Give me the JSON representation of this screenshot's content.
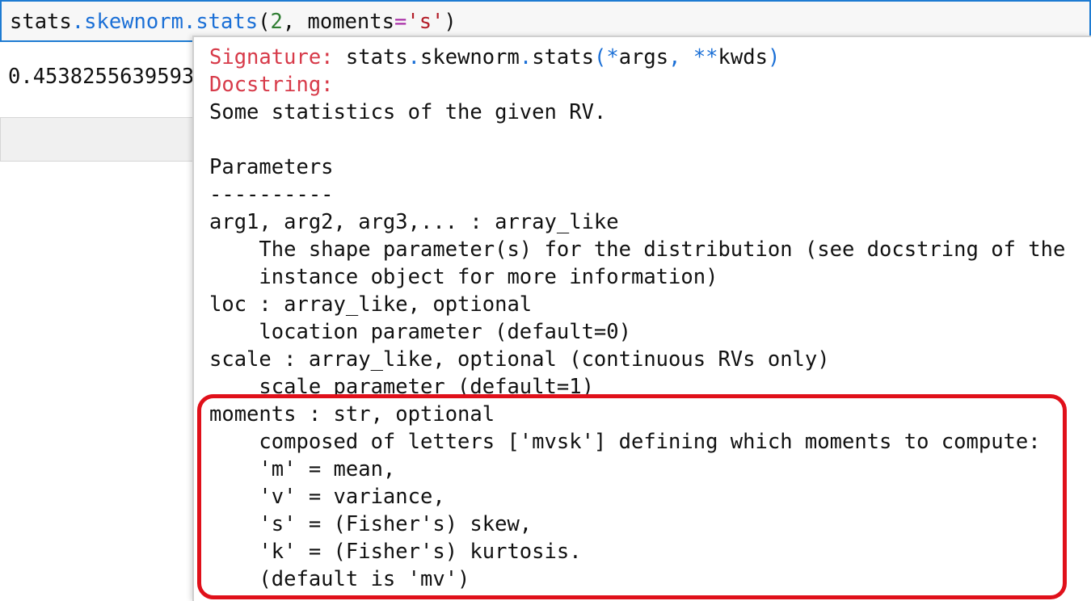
{
  "code_cell": {
    "tokens": {
      "var": "stats",
      "dot1": ".",
      "module": "skewnorm",
      "dot2": ".",
      "fn": "stats",
      "paren_open": "(",
      "num": "2",
      "comma": ", ",
      "kw": "moments",
      "eq": "=",
      "str": "'s'",
      "paren_close": ")"
    }
  },
  "output": {
    "value": "0.4538255639593"
  },
  "tooltip": {
    "signature_label": "Signature:",
    "signature": {
      "pre": " stats",
      "dot1": ".",
      "mod": "skewnorm",
      "dot2": ".",
      "fn": "stats",
      "paren_open": "(",
      "star1": "*",
      "args": "args",
      "comma": ", ",
      "star2": "**",
      "kwds": "kwds",
      "paren_close": ")"
    },
    "docstring_label": "Docstring:",
    "lines": [
      "Some statistics of the given RV.",
      "",
      "Parameters",
      "----------",
      "arg1, arg2, arg3,... : array_like",
      "    The shape parameter(s) for the distribution (see docstring of the",
      "    instance object for more information)",
      "loc : array_like, optional",
      "    location parameter (default=0)",
      "scale : array_like, optional (continuous RVs only)",
      "    scale parameter (default=1)",
      "moments : str, optional",
      "    composed of letters ['mvsk'] defining which moments to compute:",
      "    'm' = mean,",
      "    'v' = variance,",
      "    's' = (Fisher's) skew,",
      "    'k' = (Fisher's) kurtosis.",
      "    (default is 'mv')"
    ]
  },
  "colors": {
    "accent_border": "#1e7bd2",
    "label_red": "#d73a49",
    "highlight_red": "#e0101a"
  }
}
